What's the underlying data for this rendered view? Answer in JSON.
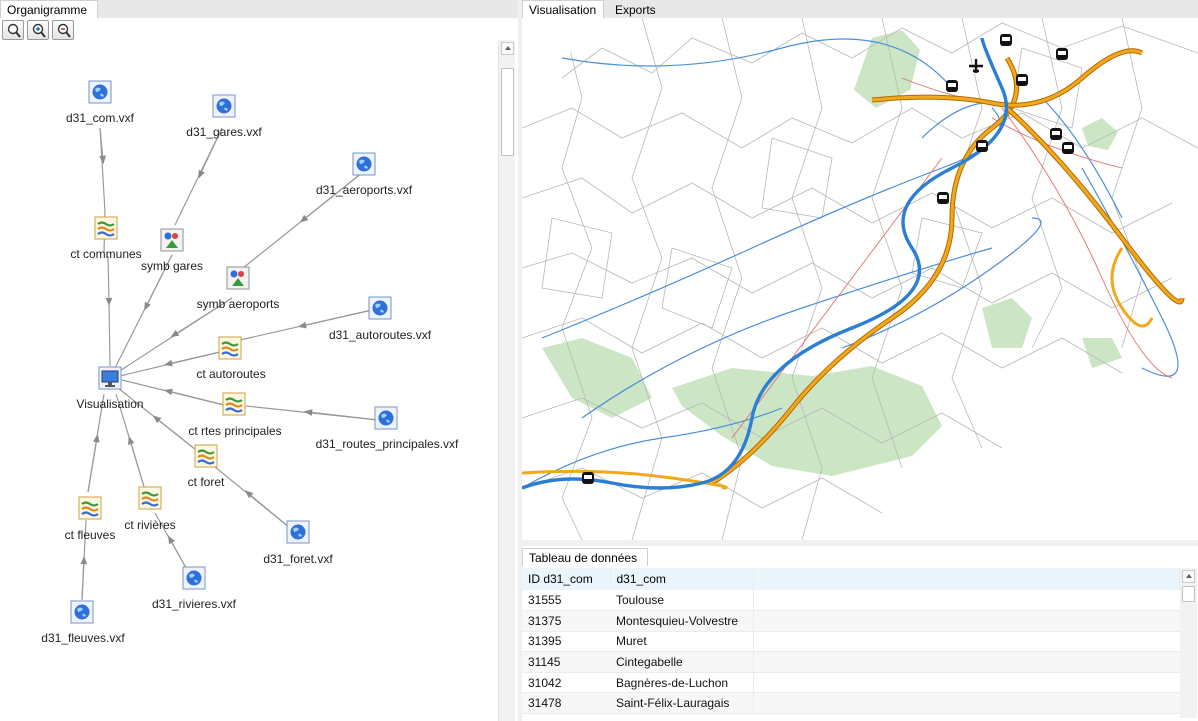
{
  "left_panel": {
    "tab_label": "Organigramme",
    "toolbar": [
      {
        "name": "zoom-icon"
      },
      {
        "name": "zoom-in-icon"
      },
      {
        "name": "zoom-out-icon"
      }
    ]
  },
  "org_nodes": {
    "d31_com": {
      "label": "d31_com.vxf",
      "icon": "globe-icon"
    },
    "d31_gares": {
      "label": "d31_gares.vxf",
      "icon": "globe-icon"
    },
    "d31_aeroports": {
      "label": "d31_aeroports.vxf",
      "icon": "globe-icon"
    },
    "ct_communes": {
      "label": "ct communes",
      "icon": "layers-icon"
    },
    "symb_gares": {
      "label": "symb gares",
      "icon": "symbol-icon"
    },
    "symb_aeroports": {
      "label": "symb aeroports",
      "icon": "symbol-icon"
    },
    "d31_autoroutes": {
      "label": "d31_autoroutes.vxf",
      "icon": "globe-icon"
    },
    "ct_autoroutes": {
      "label": "ct autoroutes",
      "icon": "layers-icon"
    },
    "visualisation": {
      "label": "Visualisation",
      "icon": "monitor-icon"
    },
    "ct_rtes_principales": {
      "label": "ct rtes principales",
      "icon": "layers-icon"
    },
    "d31_routes_principales": {
      "label": "d31_routes_principales.vxf",
      "icon": "globe-icon"
    },
    "ct_foret": {
      "label": "ct foret",
      "icon": "layers-icon"
    },
    "ct_fleuves": {
      "label": "ct fleuves",
      "icon": "layers-icon"
    },
    "ct_rivieres": {
      "label": "ct rivières",
      "icon": "layers-icon"
    },
    "d31_foret": {
      "label": "d31_foret.vxf",
      "icon": "globe-icon"
    },
    "d31_rivieres": {
      "label": "d31_rivieres.vxf",
      "icon": "globe-icon"
    },
    "d31_fleuves": {
      "label": "d31_fleuves.vxf",
      "icon": "globe-icon"
    }
  },
  "right_panel": {
    "tabs": [
      {
        "label": "Visualisation",
        "active": true
      },
      {
        "label": "Exports",
        "active": false
      }
    ],
    "colors": {
      "river": "#2a7fd4",
      "stream": "#4a8fd8",
      "motorway": "#f2a81d",
      "road": "#e07070",
      "forest": "#c6e3bf",
      "commune_border": "#b8b8b8"
    },
    "map_icons": [
      "train-station-icon",
      "airport-icon"
    ]
  },
  "data_table": {
    "tab_label": "Tableau de données",
    "columns": [
      "ID d31_com",
      "d31_com"
    ],
    "rows": [
      [
        "31555",
        "Toulouse"
      ],
      [
        "31375",
        "Montesquieu-Volvestre"
      ],
      [
        "31395",
        "Muret"
      ],
      [
        "31145",
        "Cintegabelle"
      ],
      [
        "31042",
        "Bagnères-de-Luchon"
      ],
      [
        "31478",
        "Saint-Félix-Lauragais"
      ]
    ]
  }
}
